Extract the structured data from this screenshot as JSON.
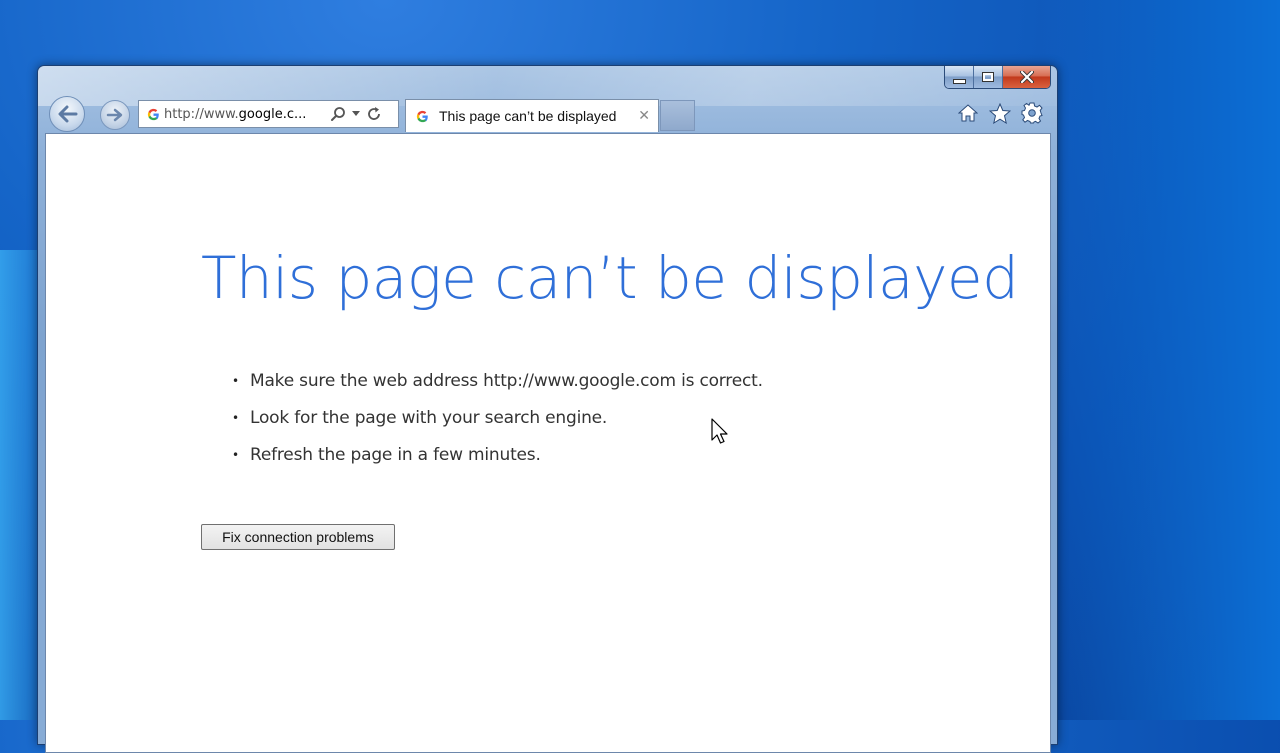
{
  "browser": {
    "address": {
      "prefix": "http://www.",
      "domain": "google.c...",
      "favicon": "google-g-icon"
    },
    "tabs": [
      {
        "title": "This page can’t be displayed",
        "favicon": "google-g-icon",
        "active": true
      }
    ],
    "toolbar_icons": [
      "home-icon",
      "favorites-star-icon",
      "settings-gear-icon"
    ],
    "caption_buttons": [
      "minimize",
      "maximize",
      "close"
    ]
  },
  "page": {
    "title": "This page can’t be displayed",
    "suggestions": [
      "Make sure the web address http://www.google.com is correct.",
      "Look for the page with your search engine.",
      "Refresh the page in a few minutes."
    ],
    "fix_button_label": "Fix connection problems"
  },
  "colors": {
    "title": "#2f6fd8",
    "desktop": "#1565c8"
  }
}
